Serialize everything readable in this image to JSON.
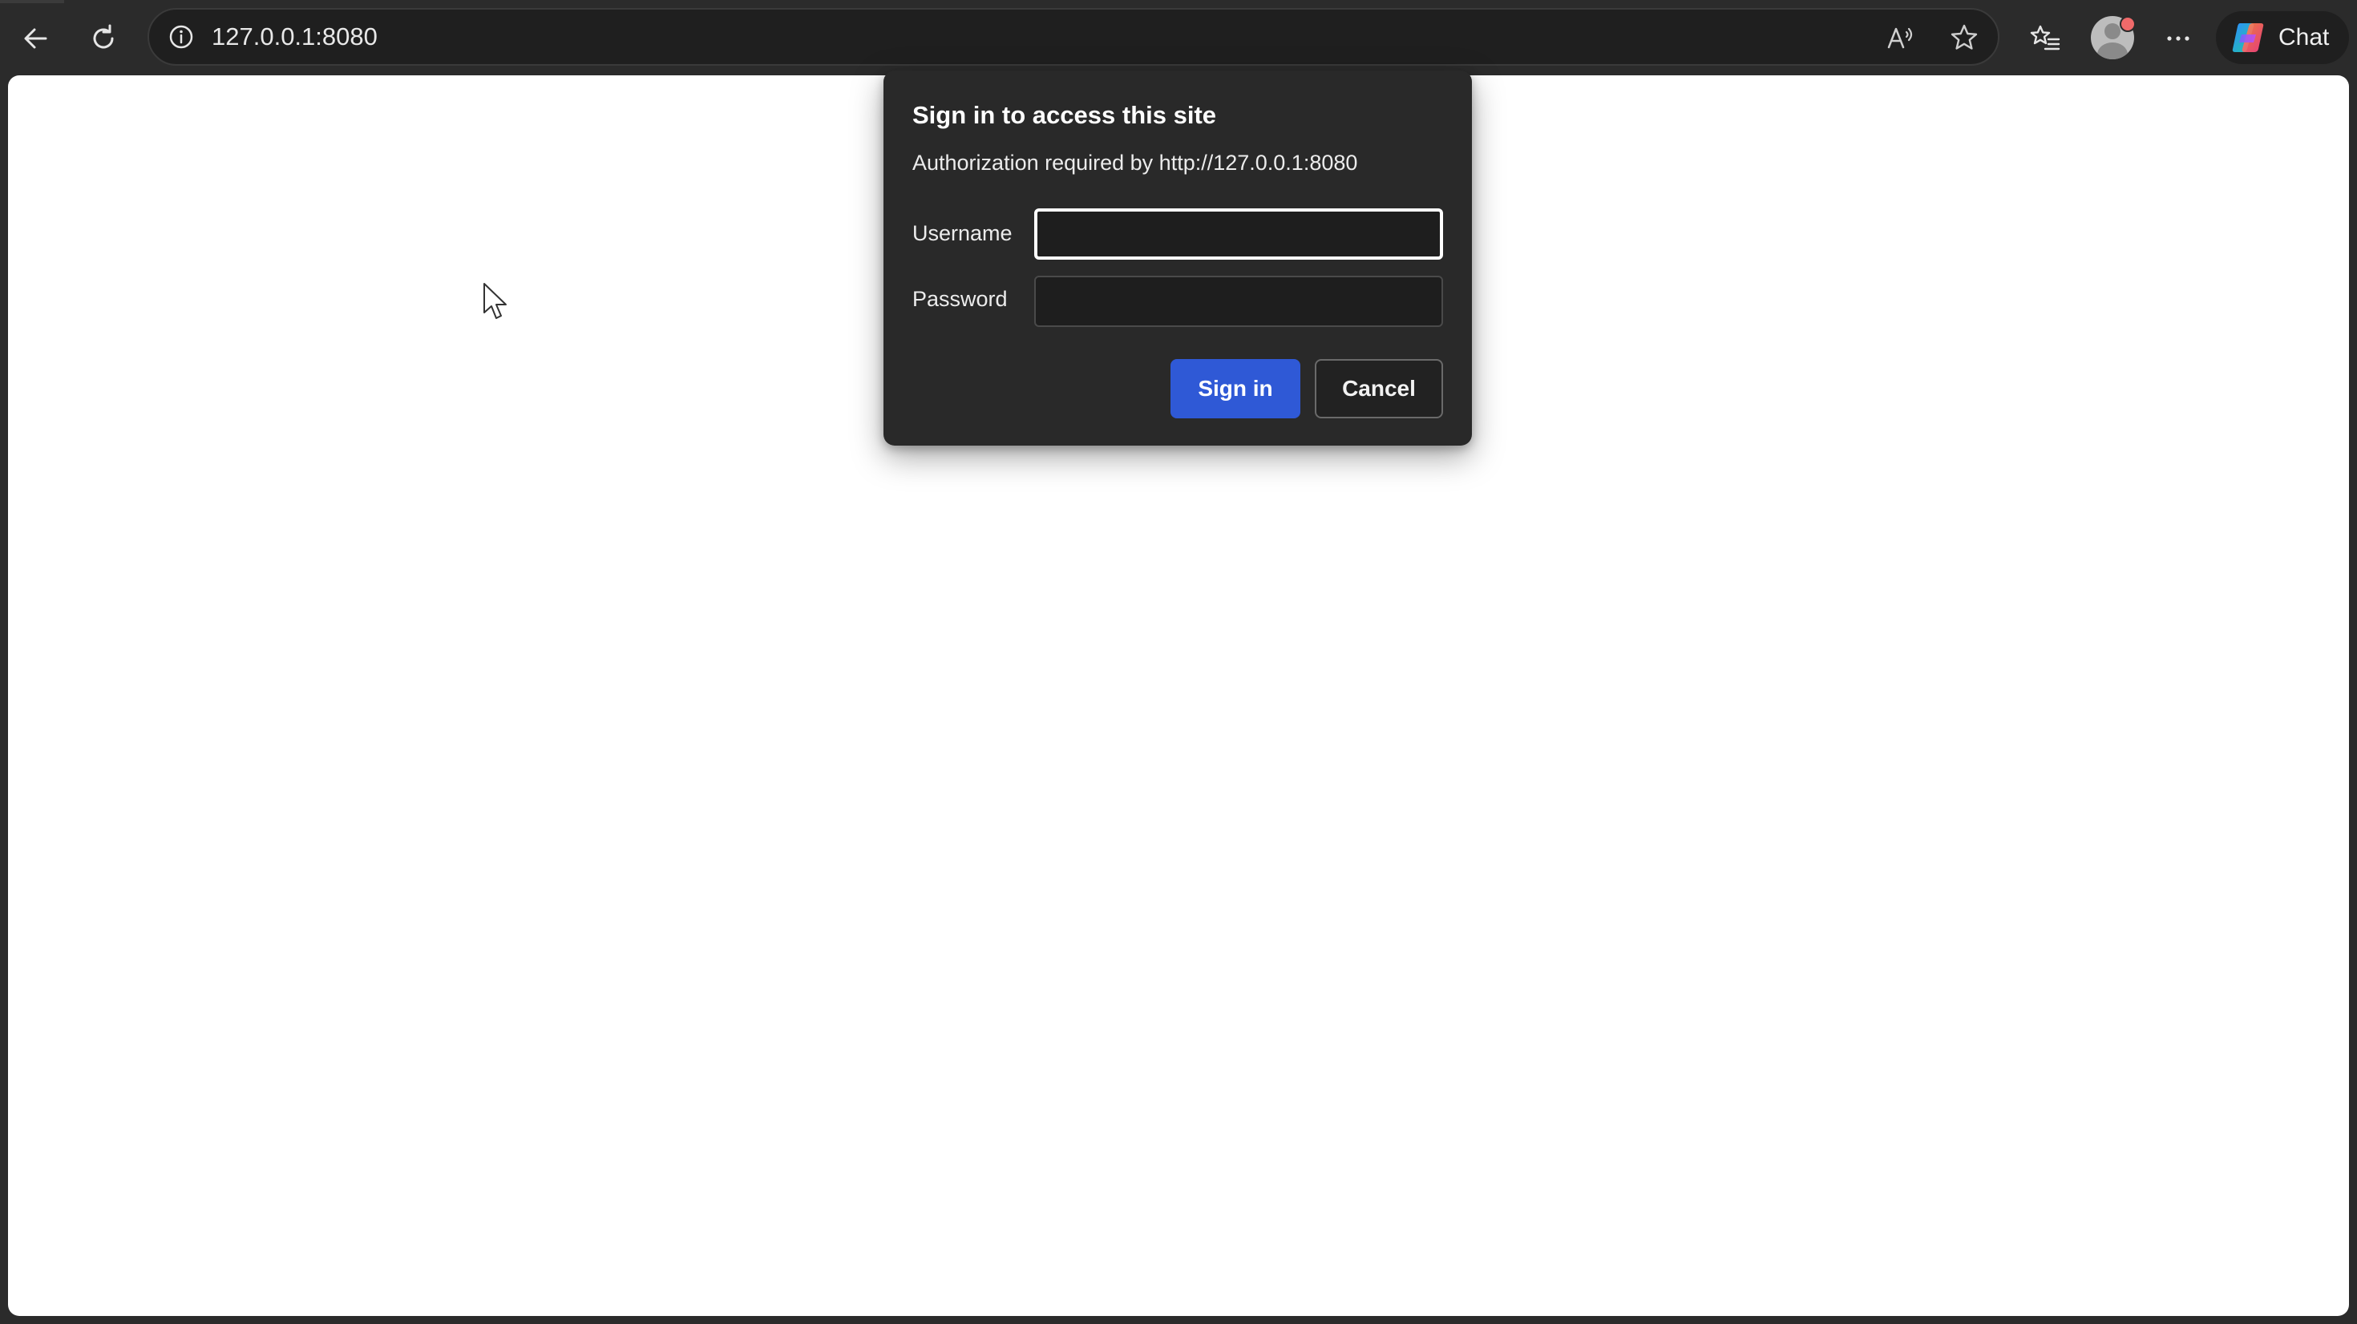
{
  "browser": {
    "url": "127.0.0.1:8080",
    "chat_label": "Chat",
    "accent_color": "#2f59d6",
    "icons": {
      "back": "back-arrow-icon",
      "refresh": "refresh-icon",
      "site_info": "info-icon",
      "read_aloud": "read-aloud-icon",
      "add_favorite": "star-icon",
      "favorites": "favorites-icon",
      "profile": "avatar",
      "more": "more-dots-icon",
      "copilot": "copilot-icon"
    }
  },
  "auth_dialog": {
    "title": "Sign in to access this site",
    "subtitle": "Authorization required by http://127.0.0.1:8080",
    "username_label": "Username",
    "username_value": "",
    "password_label": "Password",
    "password_value": "",
    "signin_label": "Sign in",
    "cancel_label": "Cancel"
  }
}
